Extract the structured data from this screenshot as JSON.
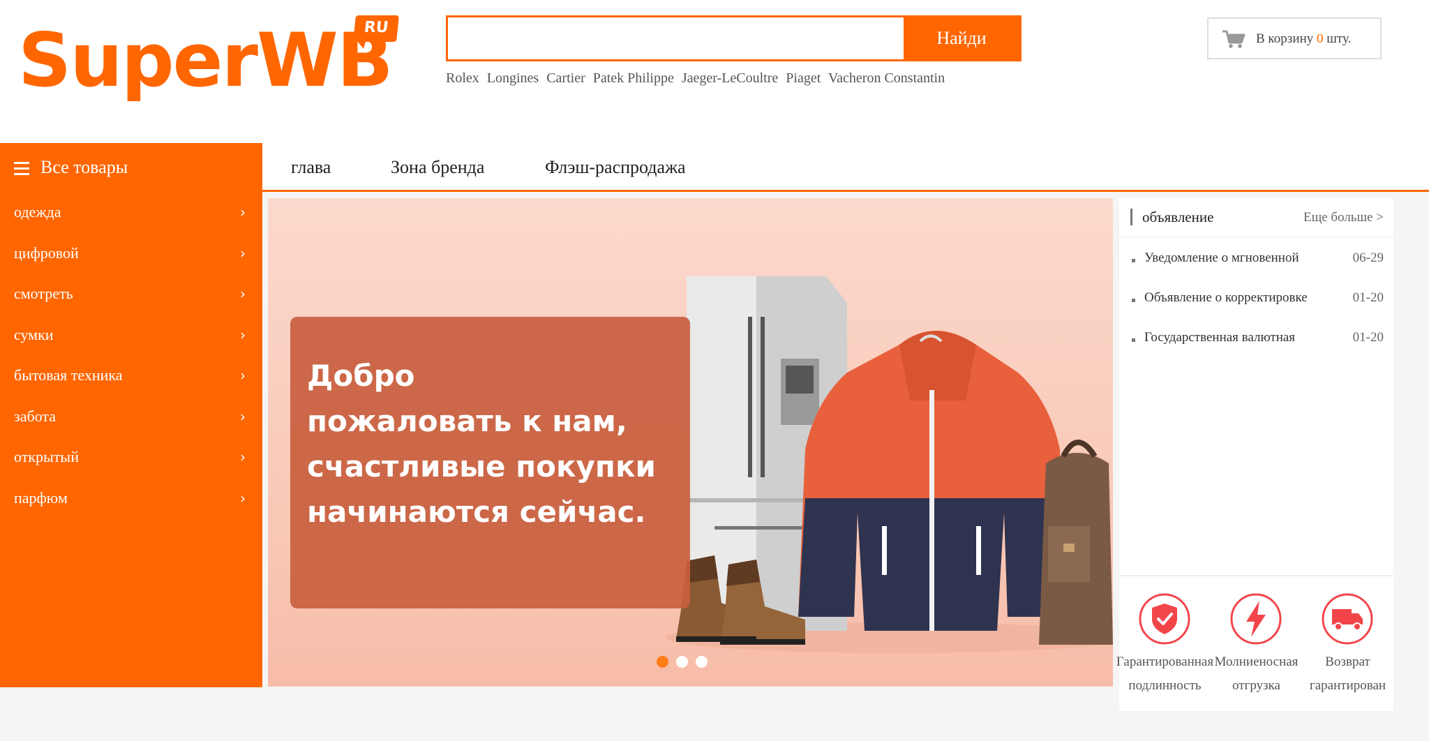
{
  "logo": {
    "text": "SuperWB",
    "badge": "RU"
  },
  "search": {
    "placeholder": "",
    "button_label": "Найди"
  },
  "hot_words": [
    "Rolex",
    "Longines",
    "Cartier",
    "Patek Philippe",
    "Jaeger-LeCoultre",
    "Piaget",
    "Vacheron Constantin"
  ],
  "cart": {
    "prefix": "В корзину",
    "count": "0",
    "suffix": "шту.",
    "icon": "shopping-cart-icon"
  },
  "sidebar": {
    "title": "Все товары",
    "items": [
      "одежда",
      "цифровой",
      "смотреть",
      "сумки",
      "бытовая техника",
      "забота",
      "открытый",
      "парфюм"
    ]
  },
  "nav": {
    "items": [
      "глава",
      "Зона бренда",
      "Флэш-распродажа"
    ]
  },
  "banner": {
    "lines": [
      "Добро",
      "пожаловать к нам,",
      "счастливые покупки",
      "начинаются сейчас."
    ],
    "slides": 3,
    "active_slide": 1
  },
  "notice": {
    "title": "объявление",
    "more": "Еще больше >",
    "items": [
      {
        "title": "Уведомление о мгновенной",
        "date": "06-29"
      },
      {
        "title": "Объявление о корректировке",
        "date": "01-20"
      },
      {
        "title": "Государственная валютная",
        "date": "01-20"
      }
    ]
  },
  "features": [
    {
      "icon": "shield-check-icon",
      "line1": "Гарантированная",
      "line2": "подлинность"
    },
    {
      "icon": "lightning-icon",
      "line1": "Молниеносная",
      "line2": "отгрузка"
    },
    {
      "icon": "delivery-truck-icon",
      "line1": "Возврат",
      "line2": "гарантирован"
    }
  ],
  "colors": {
    "accent": "#ff6600",
    "banner_bg": "#f9c9b8",
    "welcome_box": "#c8603f"
  }
}
